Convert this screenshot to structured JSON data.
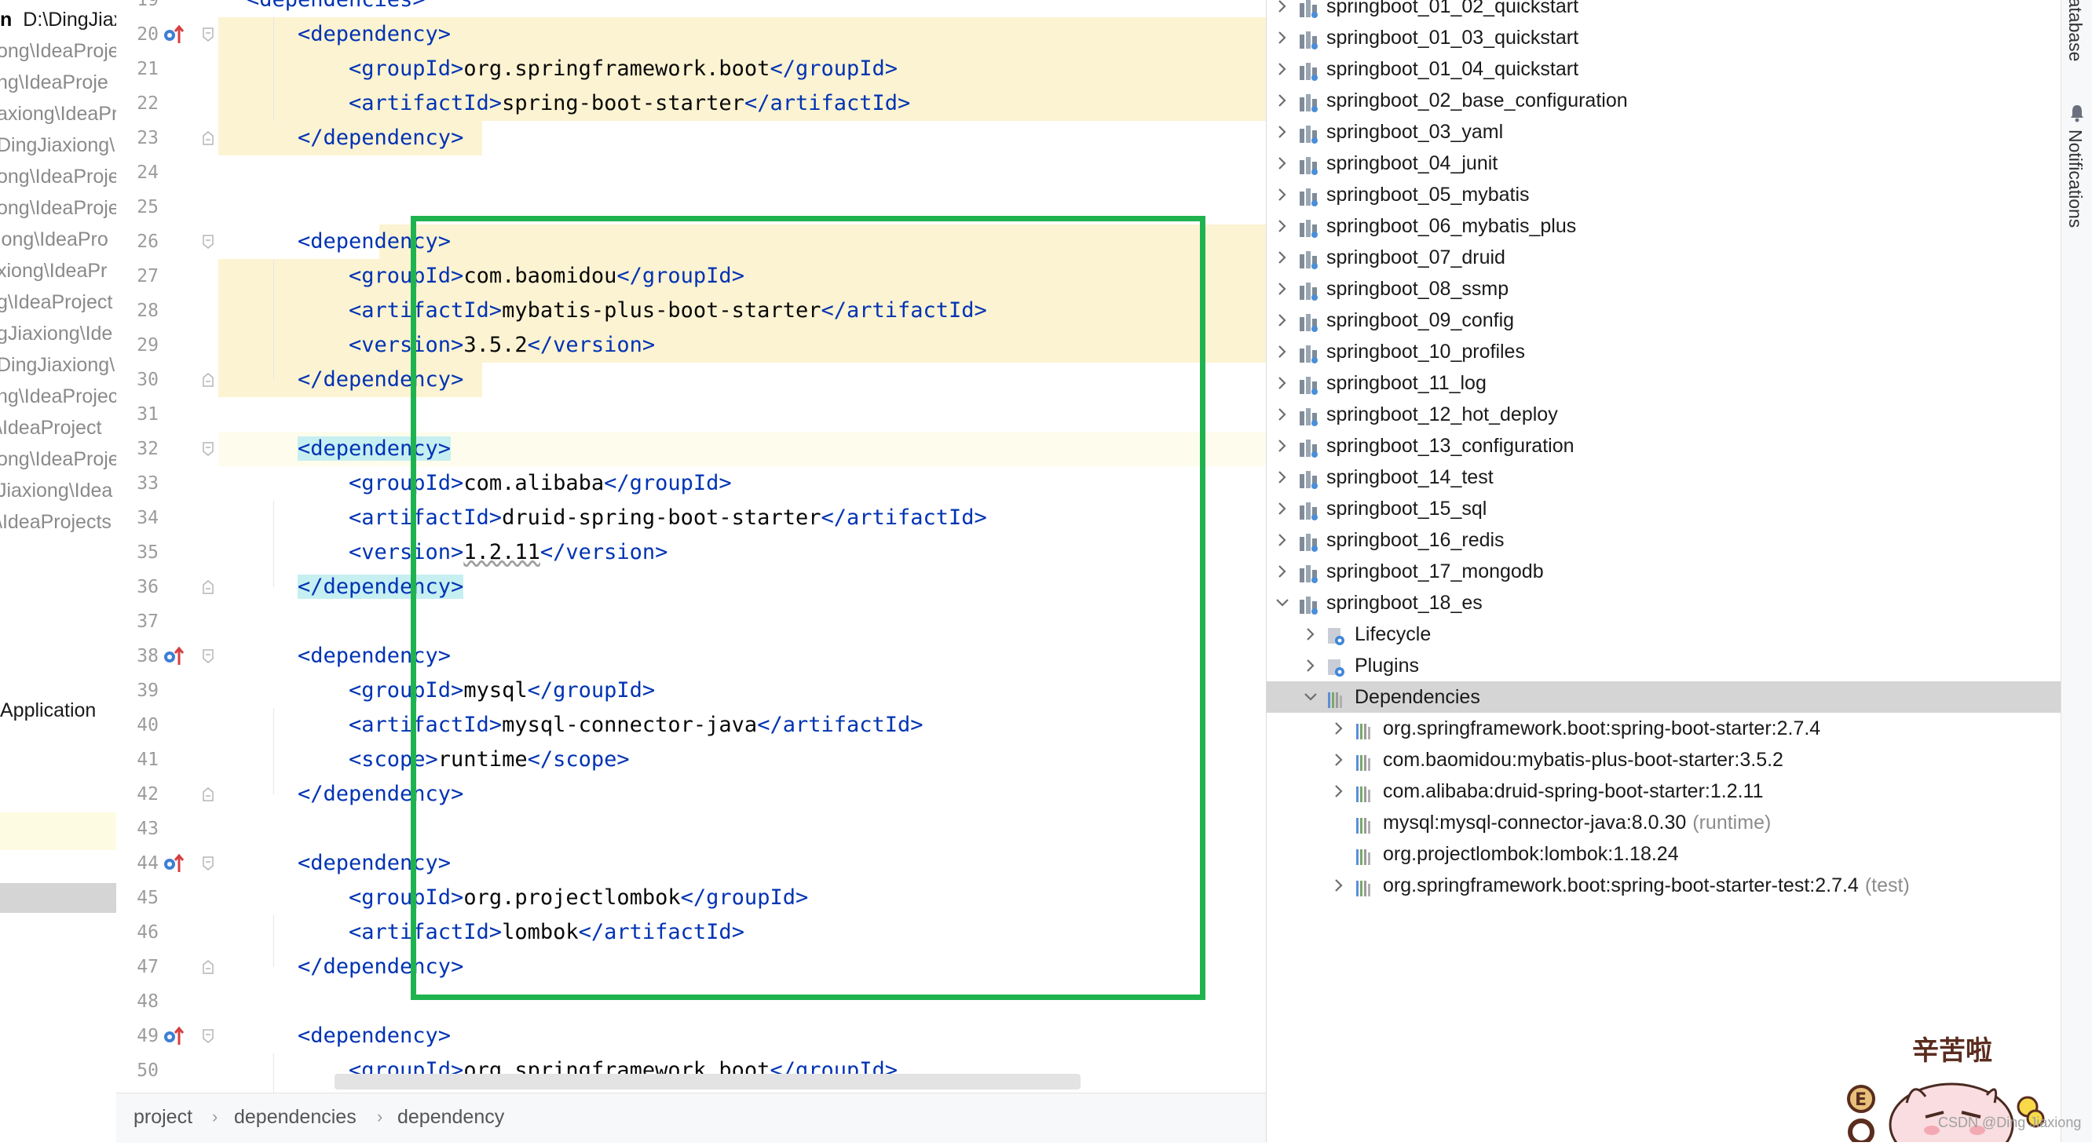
{
  "project_strip": {
    "rows": [
      {
        "bold": "n",
        "text": "D:\\DingJiax"
      },
      {
        "text": "ong\\IdeaProje"
      },
      {
        "text": "ng\\IdeaProje"
      },
      {
        "text": "axiong\\IdeaPr"
      },
      {
        "text": "DingJiaxiong\\I"
      },
      {
        "text": "ong\\IdeaProje"
      },
      {
        "text": "ong\\IdeaProje"
      },
      {
        "text": "iong\\IdeaPro"
      },
      {
        "text": "xiong\\IdeaPr"
      },
      {
        "text": "g\\IdeaProject"
      },
      {
        "text": "gJiaxiong\\Ide"
      },
      {
        "text": "DingJiaxiong\\"
      },
      {
        "text": "ng\\IdeaProjec"
      },
      {
        "text": "\\IdeaProject"
      },
      {
        "text": "ong\\IdeaProje"
      },
      {
        "text": "Jiaxiong\\Idea"
      },
      {
        "text": "\\IdeaProjects"
      }
    ],
    "app_label": "Application"
  },
  "editor": {
    "line_numbers": [
      "19",
      "20",
      "21",
      "22",
      "23",
      "24",
      "25",
      "26",
      "27",
      "28",
      "29",
      "30",
      "31",
      "32",
      "33",
      "34",
      "35",
      "36",
      "37",
      "38",
      "39",
      "40",
      "41",
      "42",
      "43",
      "44",
      "45",
      "46",
      "47",
      "48",
      "49",
      "50"
    ],
    "code_lines": [
      {
        "pre": "",
        "tag": "<dependencies>",
        "mid": "",
        "close": ""
      },
      {
        "pre": "    ",
        "tag": "<dependency>",
        "mid": "",
        "close": ""
      },
      {
        "pre": "        ",
        "tag": "<groupId>",
        "mid": "org.springframework.boot",
        "close": "</groupId>"
      },
      {
        "pre": "        ",
        "tag": "<artifactId>",
        "mid": "spring-boot-starter",
        "close": "</artifactId>"
      },
      {
        "pre": "    ",
        "tag": "</dependency>",
        "mid": "",
        "close": ""
      },
      {
        "pre": "",
        "tag": "",
        "mid": "",
        "close": ""
      },
      {
        "pre": "",
        "tag": "",
        "mid": "",
        "close": ""
      },
      {
        "pre": "    ",
        "tag": "<dependency>",
        "mid": "",
        "close": ""
      },
      {
        "pre": "        ",
        "tag": "<groupId>",
        "mid": "com.baomidou",
        "close": "</groupId>"
      },
      {
        "pre": "        ",
        "tag": "<artifactId>",
        "mid": "mybatis-plus-boot-starter",
        "close": "</artifactId>"
      },
      {
        "pre": "        ",
        "tag": "<version>",
        "mid": "3.5.2",
        "close": "</version>"
      },
      {
        "pre": "    ",
        "tag": "</dependency>",
        "mid": "",
        "close": ""
      },
      {
        "pre": "",
        "tag": "",
        "mid": "",
        "close": ""
      },
      {
        "pre": "    ",
        "tag": "<dependency>",
        "mid": "",
        "close": ""
      },
      {
        "pre": "        ",
        "tag": "<groupId>",
        "mid": "com.alibaba",
        "close": "</groupId>"
      },
      {
        "pre": "        ",
        "tag": "<artifactId>",
        "mid": "druid-spring-boot-starter",
        "close": "</artifactId>"
      },
      {
        "pre": "        ",
        "tag": "<version>",
        "mid": "1.2.11",
        "close": "</version>"
      },
      {
        "pre": "    ",
        "tag": "</dependency>",
        "mid": "",
        "close": ""
      },
      {
        "pre": "",
        "tag": "",
        "mid": "",
        "close": ""
      },
      {
        "pre": "    ",
        "tag": "<dependency>",
        "mid": "",
        "close": ""
      },
      {
        "pre": "        ",
        "tag": "<groupId>",
        "mid": "mysql",
        "close": "</groupId>"
      },
      {
        "pre": "        ",
        "tag": "<artifactId>",
        "mid": "mysql-connector-java",
        "close": "</artifactId>"
      },
      {
        "pre": "        ",
        "tag": "<scope>",
        "mid": "runtime",
        "close": "</scope>"
      },
      {
        "pre": "    ",
        "tag": "</dependency>",
        "mid": "",
        "close": ""
      },
      {
        "pre": "",
        "tag": "",
        "mid": "",
        "close": ""
      },
      {
        "pre": "    ",
        "tag": "<dependency>",
        "mid": "",
        "close": ""
      },
      {
        "pre": "        ",
        "tag": "<groupId>",
        "mid": "org.projectlombok",
        "close": "</groupId>"
      },
      {
        "pre": "        ",
        "tag": "<artifactId>",
        "mid": "lombok",
        "close": "</artifactId>"
      },
      {
        "pre": "    ",
        "tag": "</dependency>",
        "mid": "",
        "close": ""
      },
      {
        "pre": "",
        "tag": "",
        "mid": "",
        "close": ""
      },
      {
        "pre": "    ",
        "tag": "<dependency>",
        "mid": "",
        "close": ""
      },
      {
        "pre": "        ",
        "tag": "<groupId>",
        "mid": "org.springframework.boot",
        "close": "</groupId>"
      }
    ],
    "breadcrumb": [
      "project",
      "dependencies",
      "dependency"
    ],
    "highlight_color": "#1fb350"
  },
  "maven": {
    "modules": [
      "springboot_01_02_quickstart",
      "springboot_01_03_quickstart",
      "springboot_01_04_quickstart",
      "springboot_02_base_configuration",
      "springboot_03_yaml",
      "springboot_04_junit",
      "springboot_05_mybatis",
      "springboot_06_mybatis_plus",
      "springboot_07_druid",
      "springboot_08_ssmp",
      "springboot_09_config",
      "springboot_10_profiles",
      "springboot_11_log",
      "springboot_12_hot_deploy",
      "springboot_13_configuration",
      "springboot_14_test",
      "springboot_15_sql",
      "springboot_16_redis",
      "springboot_17_mongodb",
      "springboot_18_es"
    ],
    "children": [
      {
        "label": "Lifecycle",
        "icon": "lifecycle-icon"
      },
      {
        "label": "Plugins",
        "icon": "plugins-icon"
      },
      {
        "label": "Dependencies",
        "icon": "dependencies-icon"
      }
    ],
    "dependencies": [
      {
        "label": "org.springframework.boot:spring-boot-starter:2.7.4",
        "extra": "",
        "expandable": true
      },
      {
        "label": "com.baomidou:mybatis-plus-boot-starter:3.5.2",
        "extra": "",
        "expandable": true
      },
      {
        "label": "com.alibaba:druid-spring-boot-starter:1.2.11",
        "extra": "",
        "expandable": true
      },
      {
        "label": "mysql:mysql-connector-java:8.0.30",
        "extra": "(runtime)",
        "expandable": false
      },
      {
        "label": "org.projectlombok:lombok:1.18.24",
        "extra": "",
        "expandable": false
      },
      {
        "label": "org.springframework.boot:spring-boot-starter-test:2.7.4",
        "extra": "(test)",
        "expandable": true
      }
    ]
  },
  "right_strip": {
    "database": "Database",
    "notifications": "Notifications"
  },
  "sticker": {
    "text": "辛苦啦",
    "watermark": "CSDN @Ding Jiaxiong"
  }
}
